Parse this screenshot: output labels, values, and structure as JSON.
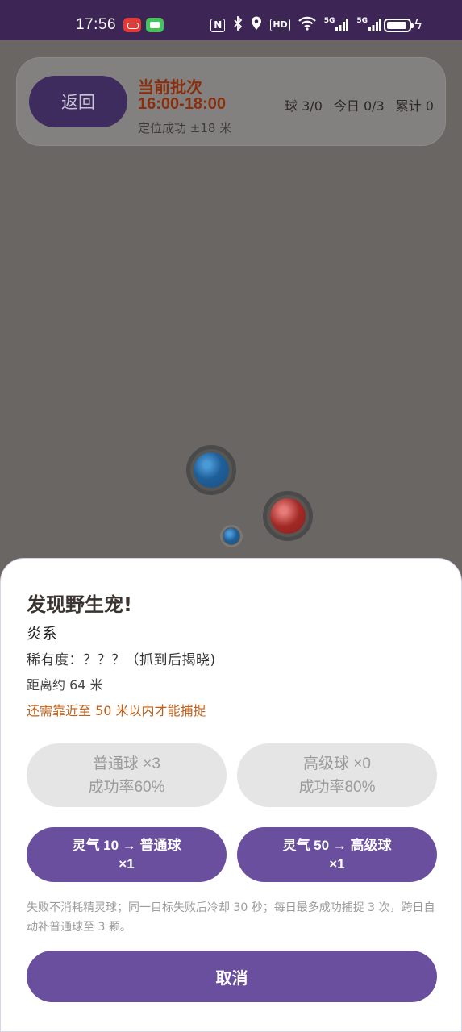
{
  "status_bar": {
    "time": "17:56",
    "icons": [
      "nfc-icon",
      "bluetooth-icon",
      "location-icon",
      "hd-icon",
      "wifi-icon",
      "5g-signal-icon",
      "5g-signal-icon",
      "battery-icon",
      "charging-icon"
    ],
    "nfc": "N",
    "hd": "HD",
    "signal_1": "5G",
    "signal_2": "5G"
  },
  "top_card": {
    "back_label": "返回",
    "batch_title": "当前批次",
    "batch_time": "16:00-18:00",
    "location_status": "定位成功 ±18 米",
    "stats": {
      "balls": "球 3/0",
      "today": "今日 0/3",
      "total": "累计 0"
    }
  },
  "map": {
    "markers": [
      {
        "name": "blue-pet-marker",
        "color": "#1f5f99"
      },
      {
        "name": "red-pet-marker",
        "color": "#a12a26"
      },
      {
        "name": "player-location-marker",
        "color": "#1f5f99"
      }
    ]
  },
  "sheet": {
    "title": "发现野生宠!",
    "element": "炎系",
    "rarity": "稀有度：？？？（抓到后揭晓)",
    "distance": "距离约 64 米",
    "warning": "还需靠近至 50 米以内才能捕捉",
    "normal_ball": {
      "label": "普通球 ×3",
      "rate": "成功率60%"
    },
    "advanced_ball": {
      "label": "高级球 ×0",
      "rate": "成功率80%"
    },
    "exchange_normal": {
      "line1": "灵气 10 → 普通球",
      "line2": "×1"
    },
    "exchange_advanced": {
      "line1": "灵气 50 → 高级球",
      "line2": "×1"
    },
    "note": "失败不消耗精灵球；同一目标失败后冷却 30 秒；每日最多成功捕捉 3 次，跨日自动补普通球至 3 颗。",
    "cancel_label": "取消"
  },
  "colors": {
    "status_bar_bg": "#3d2556",
    "accent_purple": "#6a4f9f",
    "batch_text": "#8a2f0e",
    "warning_text": "#c0621a",
    "overlay": "#6a6663"
  }
}
